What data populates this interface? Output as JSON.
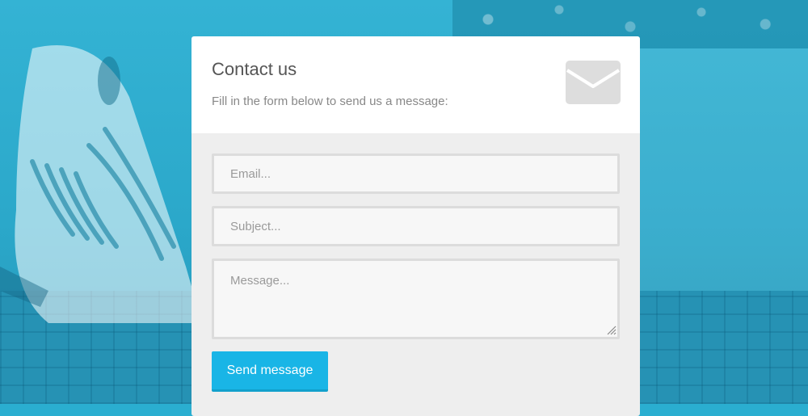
{
  "form": {
    "title": "Contact us",
    "subtitle": "Fill in the form below to send us a message:",
    "icon": "envelope-icon",
    "fields": {
      "email": {
        "placeholder": "Email...",
        "value": ""
      },
      "subject": {
        "placeholder": "Subject...",
        "value": ""
      },
      "message": {
        "placeholder": "Message...",
        "value": ""
      }
    },
    "submit_label": "Send message"
  },
  "colors": {
    "background_tint": "#2aaed0",
    "card_header": "#ffffff",
    "card_body": "#eeeeee",
    "field_background": "#f7f7f7",
    "field_border": "#dcdcdc",
    "button": "#19b5e6",
    "icon": "#dddddd"
  }
}
